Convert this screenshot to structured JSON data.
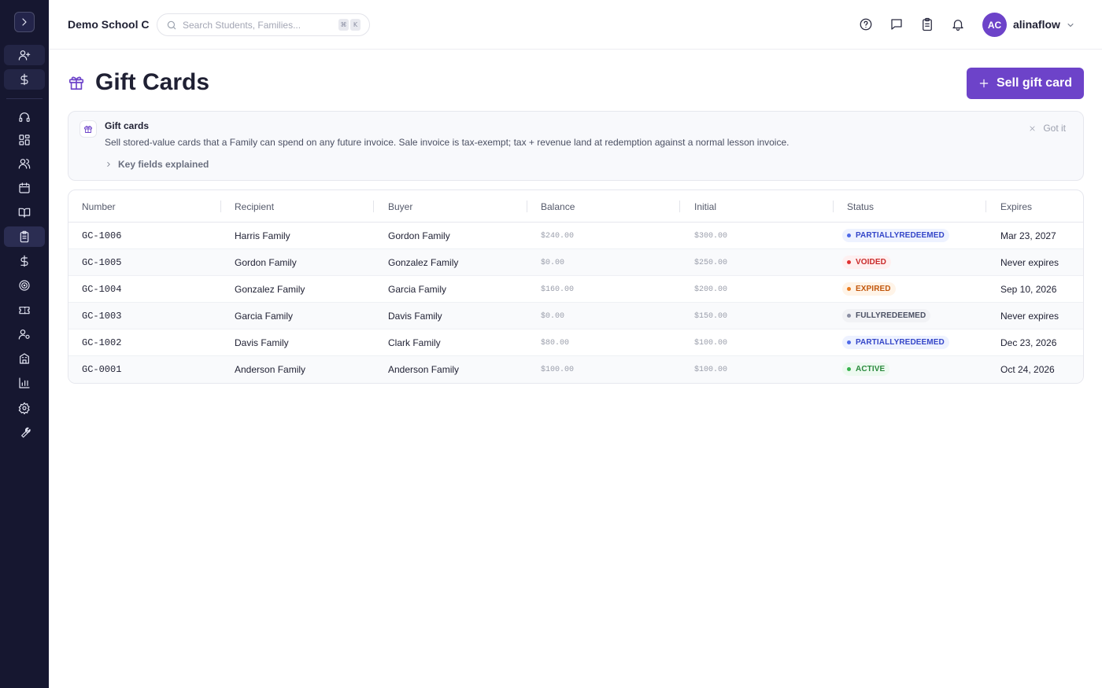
{
  "app": {
    "school_name": "Demo School C",
    "search_placeholder": "Search Students, Families...",
    "search_shortcut": [
      "⌘",
      "K"
    ],
    "user": {
      "initials": "AC",
      "name": "alinaflow"
    }
  },
  "sidebar": {
    "items": [
      {
        "icon": "add-user-icon",
        "state": "boxed"
      },
      {
        "icon": "dollar-icon",
        "state": "boxed"
      },
      {
        "icon": "headset-icon"
      },
      {
        "icon": "dashboard-icon"
      },
      {
        "icon": "users-icon"
      },
      {
        "icon": "calendar-icon"
      },
      {
        "icon": "book-icon"
      },
      {
        "icon": "clipboard-icon",
        "state": "active"
      },
      {
        "icon": "dollar-icon"
      },
      {
        "icon": "target-icon"
      },
      {
        "icon": "ticket-icon"
      },
      {
        "icon": "user-settings-icon"
      },
      {
        "icon": "building-icon"
      },
      {
        "icon": "bar-chart-icon"
      },
      {
        "icon": "gear-icon"
      },
      {
        "icon": "wrench-icon"
      }
    ]
  },
  "page": {
    "title": "Gift Cards",
    "sell_button_label": "Sell gift card"
  },
  "banner": {
    "title": "Gift cards",
    "text": "Sell stored-value cards that a Family can spend on any future invoice. Sale invoice is tax-exempt; tax + revenue land at redemption against a normal lesson invoice.",
    "toggle_label": "Key fields explained",
    "dismiss_label": "Got it"
  },
  "table": {
    "columns": [
      "Number",
      "Recipient",
      "Buyer",
      "Balance",
      "Initial",
      "Status",
      "Expires"
    ],
    "rows": [
      {
        "number": "GC-1006",
        "recipient": "Harris Family",
        "buyer": "Gordon Family",
        "balance": "$240.00",
        "initial": "$300.00",
        "status": "PARTIALLYREDEEMED",
        "expires": "Mar 23, 2027"
      },
      {
        "number": "GC-1005",
        "recipient": "Gordon Family",
        "buyer": "Gonzalez Family",
        "balance": "$0.00",
        "initial": "$250.00",
        "status": "VOIDED",
        "expires": "Never expires"
      },
      {
        "number": "GC-1004",
        "recipient": "Gonzalez Family",
        "buyer": "Garcia Family",
        "balance": "$160.00",
        "initial": "$200.00",
        "status": "EXPIRED",
        "expires": "Sep 10, 2026"
      },
      {
        "number": "GC-1003",
        "recipient": "Garcia Family",
        "buyer": "Davis Family",
        "balance": "$0.00",
        "initial": "$150.00",
        "status": "FULLYREDEEMED",
        "expires": "Never expires"
      },
      {
        "number": "GC-1002",
        "recipient": "Davis Family",
        "buyer": "Clark Family",
        "balance": "$80.00",
        "initial": "$100.00",
        "status": "PARTIALLYREDEEMED",
        "expires": "Dec 23, 2026"
      },
      {
        "number": "GC-0001",
        "recipient": "Anderson Family",
        "buyer": "Anderson Family",
        "balance": "$100.00",
        "initial": "$100.00",
        "status": "ACTIVE",
        "expires": "Oct 24, 2026"
      }
    ]
  },
  "status_colors": {
    "PARTIALLYREDEEMED": {
      "bg": "#eef2ff",
      "fg": "#3446c8",
      "dot": "#4f6ae8"
    },
    "VOIDED": {
      "bg": "#fef0f0",
      "fg": "#c92a2a",
      "dot": "#e03131"
    },
    "EXPIRED": {
      "bg": "#fff4e8",
      "fg": "#c2570c",
      "dot": "#ea7a1e"
    },
    "FULLYREDEEMED": {
      "bg": "#f1f2f5",
      "fg": "#4b5063",
      "dot": "#8b8fa3"
    },
    "ACTIVE": {
      "bg": "#edf9f0",
      "fg": "#2b8a3e",
      "dot": "#37b24d"
    }
  },
  "colors": {
    "accent": "#6d43c9",
    "sidebar_bg": "#161730"
  }
}
